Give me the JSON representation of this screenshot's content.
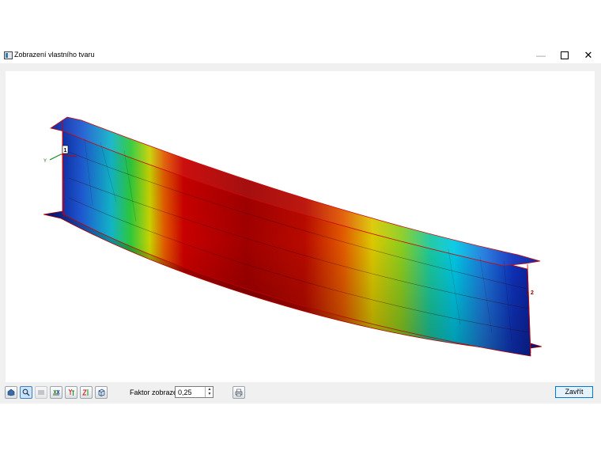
{
  "window": {
    "title": "Zobrazení vlastního tvaru",
    "controls": {
      "minimize": "—",
      "close": "✕"
    }
  },
  "viewport": {
    "node_labels": [
      "1",
      "2"
    ],
    "axis_label": "Y",
    "colors": {
      "low": "#0a1ea0",
      "mid_low": "#00c8e6",
      "mid": "#e6dc00",
      "high": "#8c0000",
      "edge": "#cc0000"
    }
  },
  "toolbar": {
    "buttons": [
      "render-mode-icon",
      "zoom-icon",
      "view-disabled-icon",
      "view-x-icon",
      "view-y-icon",
      "view-z-icon",
      "view-iso-icon"
    ],
    "factor_label": "Faktor zobrazení:",
    "factor_value": "0,25",
    "print_icon": "print-icon",
    "close_label": "Zavřít"
  }
}
